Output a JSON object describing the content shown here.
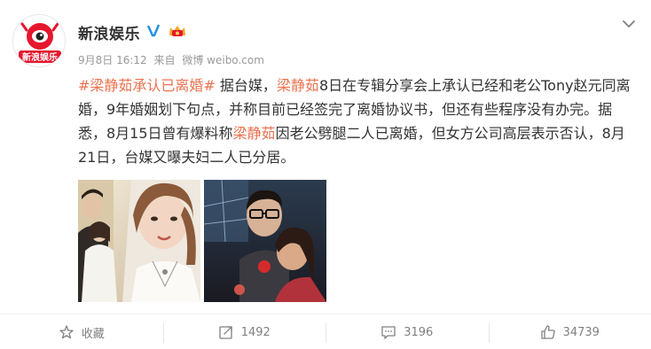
{
  "user": {
    "name": "新浪娱乐",
    "avatar_text": "新浪娱乐"
  },
  "meta": {
    "date": "9月8日 16:12",
    "source_label": "来自",
    "source": "微博 weibo.com"
  },
  "post": {
    "topic": "#梁静茹承认已离婚#",
    "segments": [
      {
        "text": " 据台媒，",
        "type": "plain"
      },
      {
        "text": "梁静茹",
        "type": "link"
      },
      {
        "text": "8日在专辑分享会上承认已经和老公Tony赵元同离婚，9年婚姻划下句点，并称目前已经签完了离婚协议书，但还有些程序没有办完。据悉，8月15日曾有爆料称",
        "type": "plain"
      },
      {
        "text": "梁静茹",
        "type": "link"
      },
      {
        "text": "因老公劈腿二人已离婚，但女方公司高层表示否认，8月21日，台媒又曝夫妇二人已分居。",
        "type": "plain"
      }
    ]
  },
  "photos": [
    {
      "alt": "photo-1"
    },
    {
      "alt": "photo-2"
    }
  ],
  "actions": {
    "favorite": "收藏",
    "repost": "1492",
    "comment": "3196",
    "like": "34739"
  },
  "colors": {
    "link": "#eb7350",
    "meta": "#999999",
    "action": "#808080",
    "avatar_red": "#e6162d"
  }
}
